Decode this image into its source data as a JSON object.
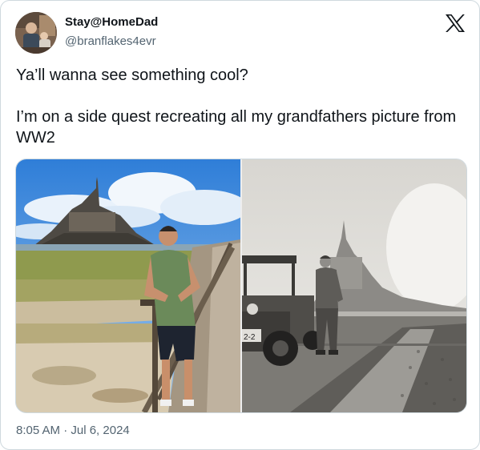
{
  "author": {
    "display_name": "Stay@HomeDad",
    "handle": "@branflakes4evr"
  },
  "tweet": {
    "line_1": "Ya’ll wanna see something cool?",
    "line_2": "I’m on a side quest recreating all my grandfathers picture from WW2",
    "timestamp": "8:05 AM · Jul 6, 2024"
  },
  "media": {
    "photos": [
      "modern-photo",
      "ww2-photo"
    ],
    "jeep_marking": "2-2"
  },
  "icons": {
    "platform_logo": "x-logo-icon"
  },
  "colors": {
    "text": "#0f1419",
    "secondary_text": "#536471",
    "border": "#cfd9de"
  }
}
